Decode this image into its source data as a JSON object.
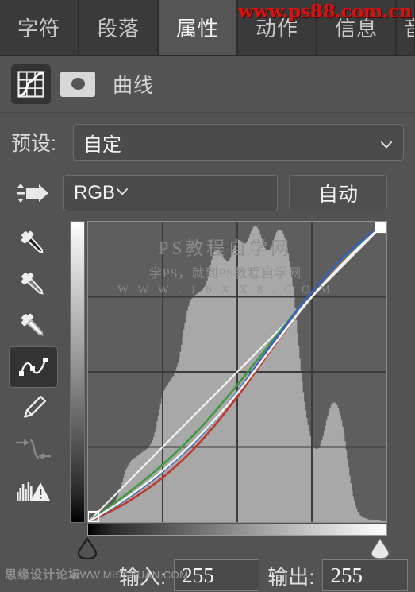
{
  "window": {
    "panel_title": "曲线",
    "background_color": "#535353"
  },
  "tabs": [
    {
      "label": "字符",
      "active": false
    },
    {
      "label": "段落",
      "active": false
    },
    {
      "label": "属性",
      "active": true
    },
    {
      "label": "动作",
      "active": false
    },
    {
      "label": "信息",
      "active": false
    },
    {
      "label": "音",
      "active": false
    }
  ],
  "header": {
    "curves_icon": "curves-adjustment-icon",
    "mask_thumbnail": "layer-mask-thumbnail",
    "title": "曲线"
  },
  "preset": {
    "label": "预设:",
    "value": "自定",
    "chevron": "chevron-down-icon"
  },
  "channel": {
    "preset_manager_icon": "preset-manager-icon",
    "value": "RGB",
    "chevron": "chevron-down-icon",
    "auto_label": "自动"
  },
  "tools": [
    {
      "name": "black-point-eyedropper-icon",
      "active": false,
      "disabled": false
    },
    {
      "name": "gray-point-eyedropper-icon",
      "active": false,
      "disabled": false
    },
    {
      "name": "white-point-eyedropper-icon",
      "active": false,
      "disabled": false
    },
    {
      "name": "curve-point-tool-icon",
      "active": true,
      "disabled": false
    },
    {
      "name": "pencil-draw-curve-icon",
      "active": false,
      "disabled": false
    },
    {
      "name": "smooth-curve-icon",
      "active": false,
      "disabled": true
    },
    {
      "name": "histogram-warning-icon",
      "active": false,
      "disabled": false
    }
  ],
  "graph": {
    "watermark_line1": "PS教程自学网",
    "watermark_line2": "学PS，就到PS教程自学网",
    "watermark_line3": "W W W . 1 6 X X 8 . C O M",
    "grid_divisions": 4,
    "black_point_marker": "curve-black-point-handle",
    "white_point_marker": "curve-white-point-handle",
    "colors": {
      "rgb_composite": "#f4f4f4",
      "red_channel": "#c0392b",
      "green_channel": "#3f9a3f",
      "blue_channel": "#3b5fc0",
      "histogram": "#a8a8a8",
      "plot_background": "#5e5e5e",
      "grid_line": "#3c3c3c"
    }
  },
  "chart_data": {
    "type": "line",
    "title": "曲线 (Curves) — RGB",
    "xlabel": "输入",
    "ylabel": "输出",
    "xlim": [
      0,
      255
    ],
    "ylim": [
      0,
      255
    ],
    "grid": true,
    "legend": "none",
    "series": [
      {
        "name": "baseline-diagonal",
        "color": "#f4f4f4",
        "points": [
          [
            0,
            0
          ],
          [
            255,
            255
          ]
        ]
      },
      {
        "name": "RGB-composite-curve",
        "color": "#f4f4f4",
        "points": [
          [
            0,
            0
          ],
          [
            32,
            20
          ],
          [
            64,
            44
          ],
          [
            96,
            74
          ],
          [
            128,
            110
          ],
          [
            160,
            152
          ],
          [
            192,
            192
          ],
          [
            224,
            226
          ],
          [
            255,
            255
          ]
        ]
      },
      {
        "name": "blue-channel-curve",
        "color": "#3b5fc0",
        "points": [
          [
            0,
            0
          ],
          [
            32,
            19
          ],
          [
            64,
            43
          ],
          [
            96,
            73
          ],
          [
            128,
            111
          ],
          [
            160,
            155
          ],
          [
            192,
            196
          ],
          [
            224,
            230
          ],
          [
            255,
            255
          ]
        ]
      },
      {
        "name": "green-channel-curve",
        "color": "#3f9a3f",
        "points": [
          [
            0,
            0
          ],
          [
            32,
            23
          ],
          [
            64,
            49
          ],
          [
            96,
            80
          ],
          [
            128,
            117
          ],
          [
            160,
            157
          ],
          [
            192,
            196
          ],
          [
            224,
            229
          ],
          [
            255,
            255
          ]
        ]
      },
      {
        "name": "red-channel-curve",
        "color": "#c0392b",
        "points": [
          [
            0,
            0
          ],
          [
            32,
            16
          ],
          [
            64,
            38
          ],
          [
            96,
            68
          ],
          [
            128,
            107
          ],
          [
            160,
            151
          ],
          [
            192,
            192
          ],
          [
            224,
            227
          ],
          [
            255,
            255
          ]
        ]
      }
    ],
    "histogram": {
      "name": "input-histogram",
      "color": "#a8a8a8",
      "bins": [
        2,
        2,
        3,
        3,
        4,
        4,
        5,
        5,
        6,
        6,
        7,
        8,
        8,
        9,
        10,
        11,
        12,
        13,
        14,
        15,
        17,
        19,
        21,
        24,
        27,
        30,
        34,
        38,
        43,
        47,
        52,
        56,
        60,
        63,
        66,
        68,
        70,
        72,
        73,
        74,
        75,
        76,
        77,
        78,
        79,
        80,
        81,
        82,
        83,
        84,
        85,
        86,
        88,
        90,
        92,
        95,
        99,
        104,
        110,
        117,
        124,
        131,
        138,
        144,
        149,
        153,
        156,
        158,
        160,
        162,
        164,
        166,
        168,
        170,
        173,
        176,
        180,
        185,
        191,
        198,
        206,
        215,
        224,
        232,
        240,
        246,
        251,
        255,
        258,
        260,
        262,
        263,
        264,
        265,
        266,
        267,
        268,
        269,
        270,
        272,
        274,
        277,
        281,
        286,
        292,
        299,
        305,
        310,
        314,
        316,
        317,
        317,
        316,
        314,
        312,
        310,
        308,
        306,
        305,
        304,
        304,
        305,
        307,
        310,
        314,
        318,
        322,
        325,
        327,
        328,
        328,
        327,
        326,
        325,
        324,
        324,
        325,
        327,
        330,
        334,
        338,
        341,
        343,
        344,
        344,
        343,
        341,
        338,
        334,
        330,
        326,
        322,
        319,
        317,
        316,
        316,
        317,
        319,
        322,
        326,
        330,
        334,
        337,
        339,
        340,
        340,
        339,
        337,
        334,
        330,
        325,
        319,
        312,
        304,
        295,
        285,
        274,
        262,
        249,
        235,
        220,
        205,
        190,
        176,
        163,
        151,
        140,
        130,
        121,
        113,
        106,
        100,
        95,
        91,
        88,
        86,
        85,
        85,
        86,
        88,
        91,
        95,
        100,
        106,
        112,
        118,
        124,
        129,
        133,
        136,
        138,
        139,
        139,
        138,
        136,
        133,
        129,
        124,
        118,
        111,
        103,
        94,
        84,
        74,
        64,
        54,
        45,
        37,
        30,
        24,
        19,
        15,
        12,
        10,
        8,
        7,
        6,
        5,
        5,
        4,
        4,
        3,
        3,
        3,
        2,
        2,
        2,
        2,
        2,
        2,
        2,
        2,
        1,
        1,
        1,
        1,
        1
      ]
    },
    "control_points": [
      {
        "input": 0,
        "output": 0,
        "label": "black-point"
      },
      {
        "input": 255,
        "output": 255,
        "label": "white-point",
        "selected": true
      }
    ]
  },
  "sliders": {
    "black_handle": "shadow-input-slider-handle",
    "white_handle": "highlight-input-slider-handle"
  },
  "io": {
    "input_label": "输入:",
    "input_value": "255",
    "output_label": "输出:",
    "output_value": "255"
  },
  "watermarks": {
    "top_right": "www.ps88.com.cn",
    "bottom_forum": "思缘设计论坛",
    "bottom_url": "WWW.MISSYUAN.COM",
    "top_right_color": "#d81111"
  }
}
